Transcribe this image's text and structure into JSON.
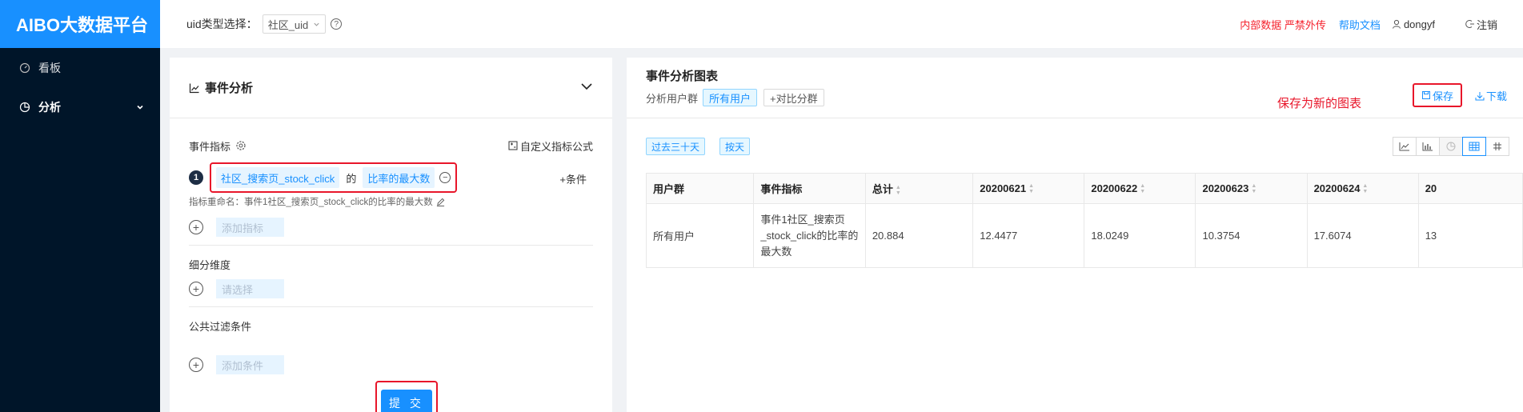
{
  "app": {
    "logo": "AIBO大数据平台"
  },
  "sidebar": {
    "items": [
      {
        "label": "看板",
        "icon": "dashboard-icon"
      },
      {
        "label": "分析",
        "icon": "pie-chart-icon"
      }
    ]
  },
  "header": {
    "uid_label": "uid类型选择：",
    "uid_value": "社区_uid",
    "warning": "内部数据 严禁外传",
    "help_doc": "帮助文档",
    "username": "dongyf",
    "logout": "注销"
  },
  "left_panel": {
    "title": "事件分析",
    "metric_label": "事件指标",
    "custom_formula": "自定义指标公式",
    "metric_index": "1",
    "metric_event": "社区_搜索页_stock_click",
    "metric_of": "的",
    "metric_agg": "比率的最大数",
    "add_condition": "+条件",
    "rename": "指标重命名：事件1社区_搜索页_stock_click的比率的最大数",
    "add_metric_placeholder": "添加指标",
    "breakdown_label": "细分维度",
    "breakdown_placeholder": "请选择",
    "filter_label": "公共过滤条件",
    "filter_placeholder": "添加条件",
    "submit": "提 交"
  },
  "right_panel": {
    "title": "事件分析图表",
    "group_label": "分析用户群",
    "group_value": "所有用户",
    "compare": "+对比分群",
    "annotation": "保存为新的图表",
    "save": "保存",
    "download": "下载",
    "range_tag": "过去三十天",
    "granularity_tag": "按天",
    "view_icons": [
      "line-chart-icon",
      "bar-chart-icon",
      "pie-chart-icon",
      "table-icon",
      "grid-icon"
    ]
  },
  "table": {
    "headers": [
      "用户群",
      "事件指标",
      "总计",
      "20200621",
      "20200622",
      "20200623",
      "20200624",
      "20"
    ],
    "rows": [
      [
        "所有用户",
        "事件1社区_搜索页_stock_click的比率的最大数",
        "20.884",
        "12.4477",
        "18.0249",
        "10.3754",
        "17.6074",
        "13"
      ]
    ]
  },
  "colors": {
    "brand": "#1890ff",
    "sidebar_bg": "#001529",
    "annotation_red": "#e8162a"
  }
}
